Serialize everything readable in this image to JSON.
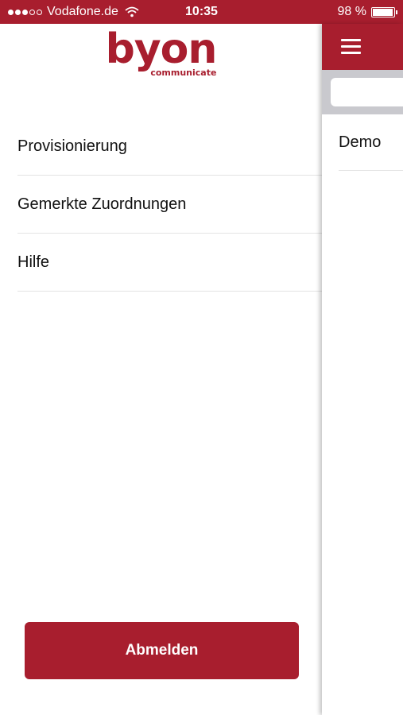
{
  "status_bar": {
    "signal_full": 3,
    "signal_total": 5,
    "carrier": "Vodafone.de",
    "time": "10:35",
    "battery": "98 %",
    "battery_level": 0.98
  },
  "drawer": {
    "logo_text": "byon",
    "logo_subtext": "communicate",
    "items": [
      {
        "label": "Provisionierung"
      },
      {
        "label": "Gemerkte Zuordnungen"
      },
      {
        "label": "Hilfe"
      }
    ],
    "logout_label": "Abmelden"
  },
  "main": {
    "list_items": [
      {
        "label": "Demo"
      }
    ]
  },
  "colors": {
    "brand": "#a81e2e",
    "search_bar_bg": "#c9c9ce",
    "divider": "#e3e3e3"
  },
  "icons": {
    "menu": "hamburger-icon",
    "wifi": "wifi-icon",
    "battery": "battery-icon"
  }
}
